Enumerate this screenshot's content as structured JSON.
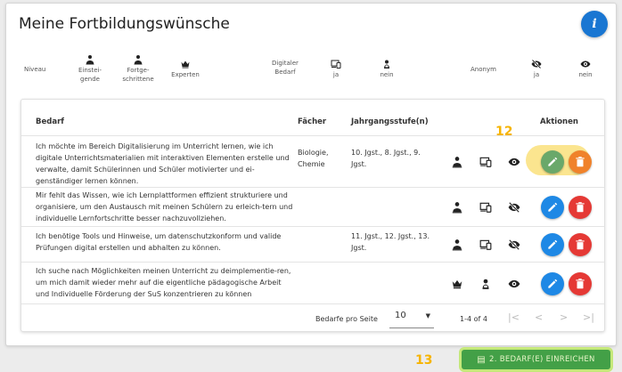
{
  "title": "Meine Fortbildungswünsche",
  "info_label": "i",
  "legend": {
    "niveau": "Niveau",
    "einsteigende": "Einstei-gende",
    "fortgeschrittene": "Fortge-schrittene",
    "experten": "Experten",
    "digitaler_bedarf": "Digitaler Bedarf",
    "ja1": "ja",
    "nein1": "nein",
    "anonym": "Anonym",
    "ja2": "ja",
    "nein2": "nein"
  },
  "table": {
    "headers": {
      "bedarf": "Bedarf",
      "faecher": "Fächer",
      "jahrgang": "Jahrgangsstufe(n)",
      "aktionen": "Aktionen"
    },
    "rows": [
      {
        "bedarf": "Ich möchte im Bereich Digitalisierung im Unterricht lernen, wie ich digitale Unterrichtsmaterialien mit interaktiven Elementen erstelle und verwalte, damit Schülerinnen und Schüler motivierter und ei-genständiger lernen können.",
        "faecher": "Biologie, Chemie",
        "jahrgang": "10. Jgst., 8. Jgst., 9. Jgst."
      },
      {
        "bedarf": "Mir fehlt das Wissen, wie ich Lernplattformen effizient strukturiere und organisiere, um den Austausch mit meinen Schülern zu erleich-tern und individuelle Lernfortschritte besser nachzuvollziehen.",
        "faecher": "",
        "jahrgang": ""
      },
      {
        "bedarf": "Ich benötige Tools und Hinweise, um datenschutzkonform und valide Prüfungen digital erstellen und abhalten zu können.",
        "faecher": "",
        "jahrgang": "11. Jgst., 12. Jgst., 13. Jgst."
      },
      {
        "bedarf": "Ich suche nach Möglichkeiten meinen Unterricht zu deimplementie-ren, um mich damit wieder mehr auf die eigentliche pädagogische Arbeit und Individuelle Förderung der SuS konzentrieren zu können",
        "faecher": "",
        "jahrgang": ""
      }
    ]
  },
  "footer": {
    "per_page_label": "Bedarfe pro Seite",
    "per_page_value": "10",
    "range": "1-4 of 4"
  },
  "annotations": {
    "n12": "12",
    "n13": "13"
  },
  "submit_label": "2. BEDARF(E) EINREICHEN",
  "icons": [
    "person-icon",
    "person-tie-icon",
    "crown-icon",
    "devices-icon",
    "no-device-icon",
    "eye-icon",
    "eye-off-icon",
    "pencil-icon",
    "trash-icon",
    "info-icon"
  ]
}
